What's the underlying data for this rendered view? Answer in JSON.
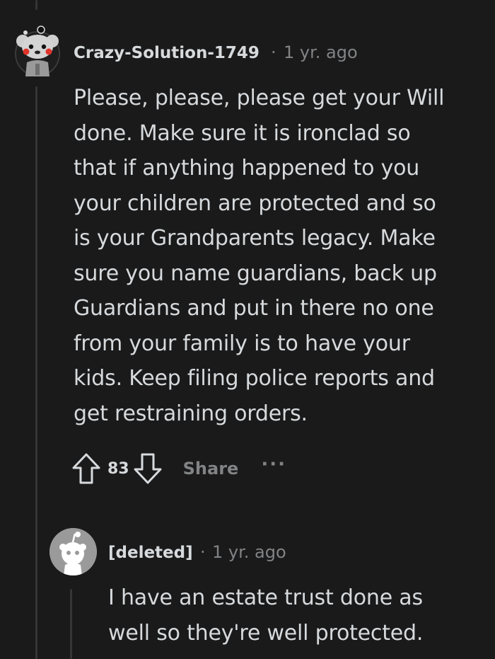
{
  "comment": {
    "username": "Crazy-Solution-1749",
    "separator": "·",
    "time": "1 yr. ago",
    "avatar_icon": "snoo-avatar-icon",
    "body": "Please, please, please get your Will\ndone. Make sure it is ironclad so\nthat if anything happened to you\nyour children are protected and so\nis your Grandparents legacy. Make\nsure you name guardians, back up\nGuardians and put in there no one\nfrom your family is to have your\nkids. Keep filing police reports and\nget restraining orders.",
    "votes": "83",
    "share_label": "Share",
    "more_label": "···"
  },
  "reply": {
    "username": "[deleted]",
    "separator": "·",
    "time": "1 yr. ago",
    "avatar_icon": "deleted-user-avatar-icon",
    "body": "I have an estate trust done as\nwell so they're well protected."
  },
  "colors": {
    "background": "#1a1a1b",
    "text": "#d7dadc",
    "muted": "#818384",
    "thread_line": "#343536"
  }
}
